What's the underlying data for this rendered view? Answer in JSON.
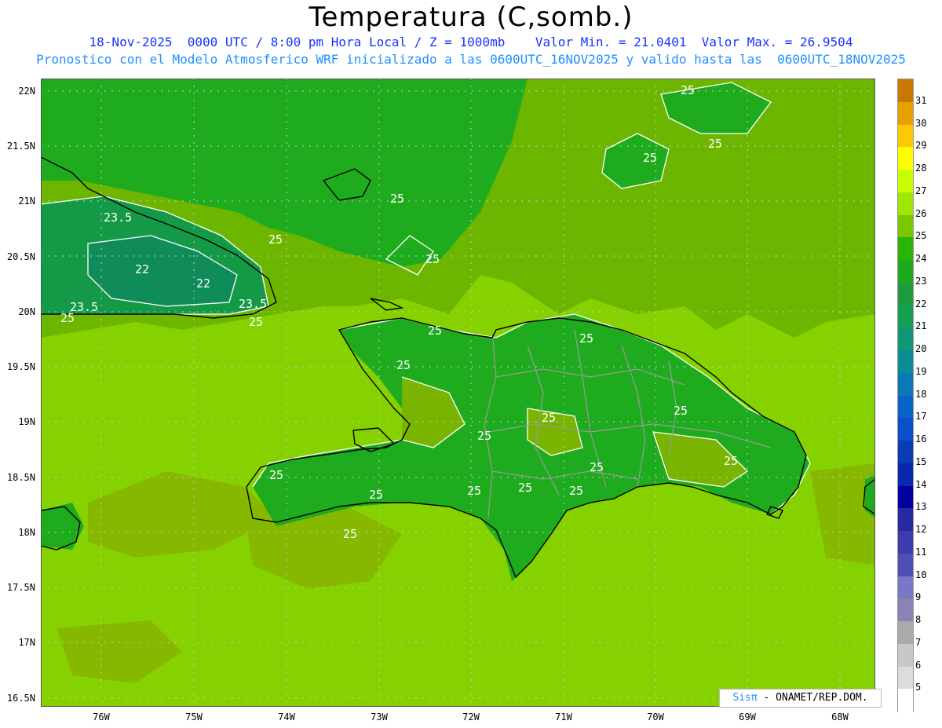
{
  "header": {
    "title": "Temperatura (C,somb.)",
    "line1": "18-Nov-2025  0000 UTC / 8:00 pm Hora Local / Z = 1000mb    Valor Min. = 21.0401  Valor Max. = 26.9504",
    "line2": "Pronostico con el Modelo Atmosferico WRF inicializado a las 0600UTC_16NOV2025 y valido hasta las  0600UTC_18NOV2025"
  },
  "axes": {
    "lat_labels": [
      "22N",
      "21.5N",
      "21N",
      "20.5N",
      "20N",
      "19.5N",
      "19N",
      "18.5N",
      "18N",
      "17.5N",
      "17N",
      "16.5N"
    ],
    "lon_labels": [
      "76W",
      "75W",
      "74W",
      "73W",
      "72W",
      "71W",
      "70W",
      "69W",
      "68W"
    ]
  },
  "colorbar": {
    "labels": [
      "31",
      "30",
      "29",
      "28",
      "27",
      "26",
      "25",
      "24",
      "23",
      "22",
      "21",
      "20",
      "19",
      "18",
      "17",
      "16",
      "15",
      "14",
      "13",
      "12",
      "11",
      "10",
      "9",
      "8",
      "7",
      "6",
      "5"
    ],
    "colors": [
      "#c87800",
      "#e6a000",
      "#ffc800",
      "#ffff00",
      "#c8ff00",
      "#a0e600",
      "#78c800",
      "#28b400",
      "#1eaa1e",
      "#1e9b3c",
      "#14a050",
      "#119678",
      "#0a8c96",
      "#0a78b4",
      "#0a64c8",
      "#0a50c8",
      "#0a3cb4",
      "#0a28aa",
      "#0000a0",
      "#2828a0",
      "#3c3caa",
      "#5050b4",
      "#7878c8",
      "#8c82b4",
      "#aaaaaa",
      "#c8c8c8",
      "#dcdcdc",
      "#ffffff"
    ]
  },
  "map": {
    "contour_labels": [
      "25",
      "25",
      "25",
      "25",
      "25",
      "25",
      "25",
      "25",
      "25",
      "25",
      "25",
      "25",
      "25",
      "25",
      "25",
      "25",
      "25",
      "25",
      "25",
      "25",
      "25",
      "25",
      "23.5",
      "23.5",
      "23.5",
      "22",
      "22"
    ]
  },
  "credit": {
    "sis": "Sisπ",
    "rest": " - ONAMET/REP.DOM."
  }
}
